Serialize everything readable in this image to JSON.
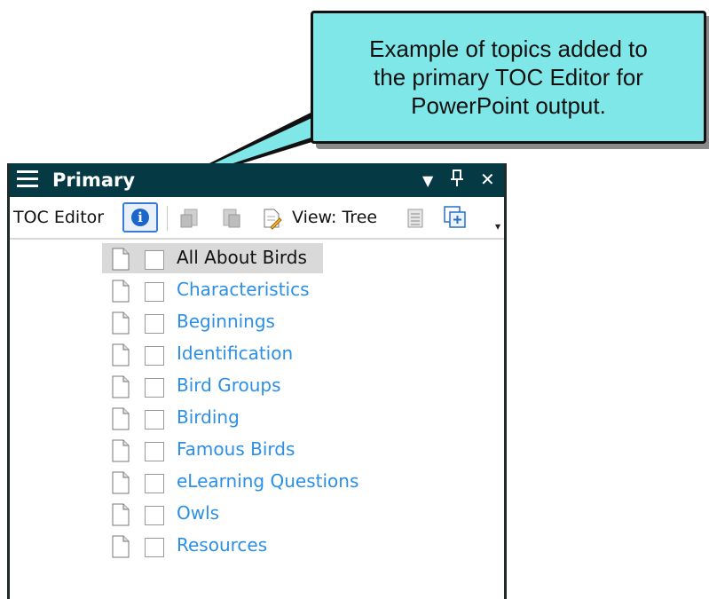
{
  "callout": {
    "text": "Example of topics added to\nthe primary TOC Editor for\nPowerPoint output."
  },
  "panel": {
    "title": "Primary",
    "dropdown_icon": "triangle-down-icon",
    "pin_icon": "pin-icon",
    "close_icon": "close-icon"
  },
  "toolbar": {
    "label": "TOC Editor",
    "info_icon": "info-icon",
    "view_label": "View: Tree",
    "overflow_icon": "overflow-chevron-icon"
  },
  "tree": {
    "items": [
      {
        "label": "All About Birds",
        "selected": true
      },
      {
        "label": "Characteristics"
      },
      {
        "label": "Beginnings"
      },
      {
        "label": "Identification"
      },
      {
        "label": "Bird Groups"
      },
      {
        "label": "Birding"
      },
      {
        "label": "Famous Birds"
      },
      {
        "label": "eLearning Questions"
      },
      {
        "label": "Owls"
      },
      {
        "label": "Resources"
      }
    ]
  },
  "colors": {
    "callout_bg": "#7fe7e7",
    "titlebar_bg": "#053a45",
    "link_blue": "#2c8fe6",
    "selected_bg": "#d9d9d9"
  }
}
